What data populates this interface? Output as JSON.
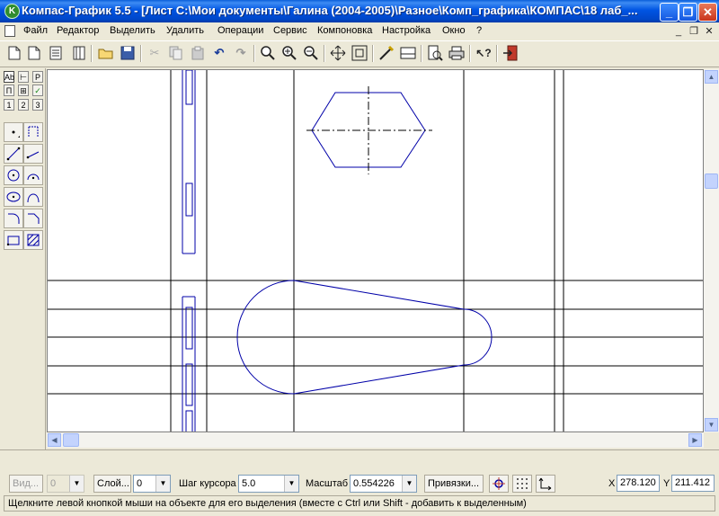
{
  "window": {
    "title": "Компас-График 5.5 - [Лист C:\\Мои документы\\Галина (2004-2005)\\Разное\\Комп_графика\\КОМПАС\\18 лаб_...",
    "app_icon": "kompas-logo-icon",
    "minimize": "_",
    "maximize": "❐",
    "close": "✕"
  },
  "menu": {
    "items": [
      "Файл",
      "Редактор",
      "Выделить",
      "Удалить",
      "Операции",
      "Сервис",
      "Компоновка",
      "Настройка",
      "Окно",
      "?"
    ],
    "doc_controls": [
      "_",
      "❐",
      "✕"
    ]
  },
  "toolbar": {
    "buttons": [
      "new-sheet-icon",
      "new-fragment-icon",
      "new-text-doc-icon",
      "new-spec-icon",
      "open-icon",
      "save-icon",
      "cut-icon",
      "copy-icon",
      "paste-icon",
      "undo-icon",
      "redo-icon",
      "zoom-window-icon",
      "zoom-in-icon",
      "zoom-out-icon",
      "pan-icon",
      "zoom-all-icon",
      "refresh-icon",
      "display-mode-icon",
      "preview-icon",
      "print-icon",
      "help-icon",
      "exit-icon"
    ]
  },
  "leftpanel": {
    "tabs_row1": [
      "Ab",
      "⊢",
      "P"
    ],
    "tabs_row2": [
      "П",
      "⊞",
      "✓"
    ],
    "tabs_row3": [
      "1",
      "2",
      "3"
    ],
    "tools": [
      "point-icon",
      "auxiliary-line-icon",
      "segment-icon",
      "parallel-segment-icon",
      "circle-icon",
      "arc-icon",
      "ellipse-icon",
      "spline-icon",
      "fillet-icon",
      "chamfer-icon",
      "rectangle-icon",
      "hatch-icon"
    ]
  },
  "status": {
    "view_btn": "Вид...",
    "view_value": "0",
    "layer_btn": "Слой...",
    "layer_value": "0",
    "step_label": "Шаг курсора",
    "step_value": "5.0",
    "scale_label": "Масштаб",
    "scale_value": "0.554226",
    "snaps_btn": "Привязки...",
    "x_label": "X",
    "x_value": "278.120",
    "y_label": "Y",
    "y_value": "211.412",
    "hint": "Щелкните левой кнопкой мыши на объекте для его выделения (вместе с Ctrl или Shift - добавить к выделенным)"
  },
  "colors": {
    "drawing_blue": "#0000a8",
    "drawing_black": "#000000",
    "titlebar": "#0054e3"
  }
}
